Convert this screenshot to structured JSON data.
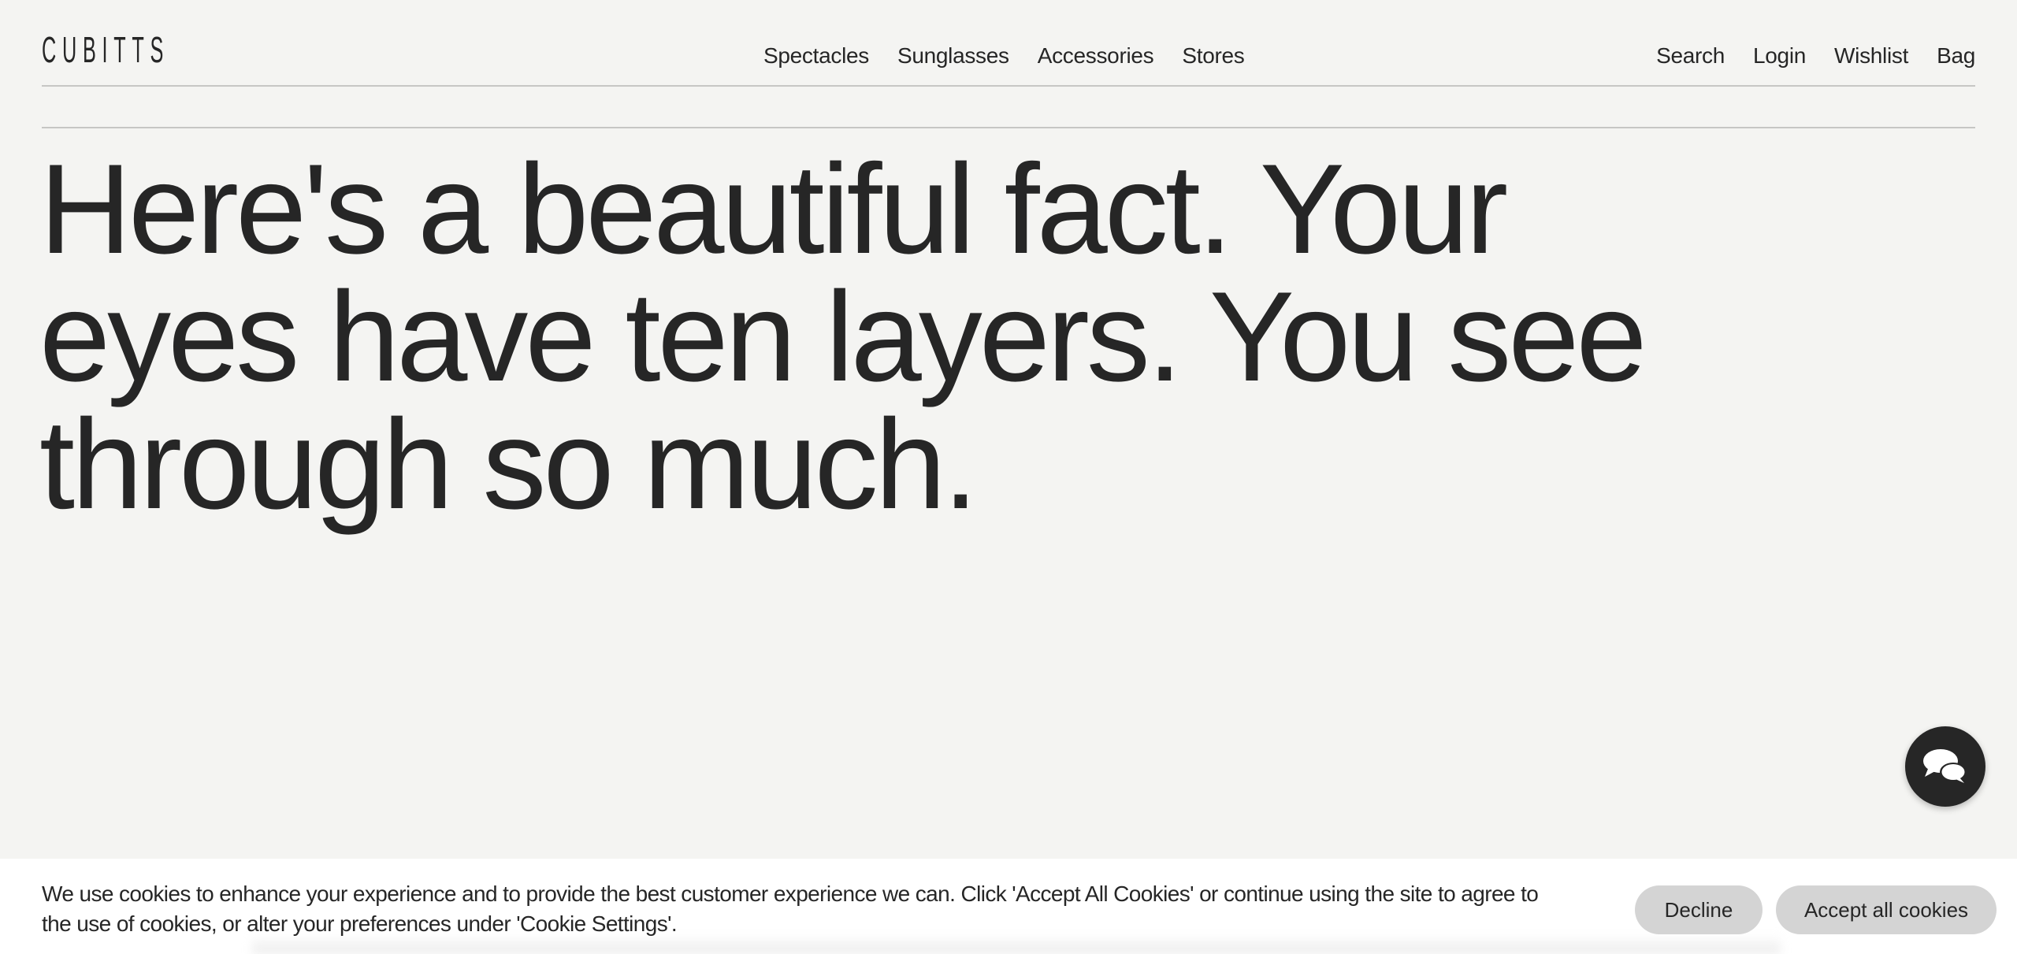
{
  "header": {
    "logo": "CUBITTS",
    "nav_main": [
      {
        "label": "Spectacles"
      },
      {
        "label": "Sunglasses"
      },
      {
        "label": "Accessories"
      },
      {
        "label": "Stores"
      }
    ],
    "nav_utility": [
      {
        "label": "Search"
      },
      {
        "label": "Login"
      },
      {
        "label": "Wishlist"
      },
      {
        "label": "Bag"
      }
    ]
  },
  "hero": {
    "lines": [
      "Here's a beautiful fact. Your",
      "eyes have ten layers. You see",
      "through so much."
    ]
  },
  "chat": {
    "icon": "chat-bubbles-icon"
  },
  "cookie_banner": {
    "text_line_1": "We use cookies to enhance your experience and to provide the best customer experience we can. Click 'Accept All Cookies' or continue using the site to agree to",
    "text_line_2": "the use of cookies, or alter your preferences under 'Cookie Settings'.",
    "decline_label": "Decline",
    "accept_label": "Accept all cookies"
  },
  "colors": {
    "background": "#f4f4f2",
    "text": "#262626",
    "rule": "#c6c6c4",
    "cookie_button": "#d4d4d4",
    "chat_button": "#262626"
  }
}
